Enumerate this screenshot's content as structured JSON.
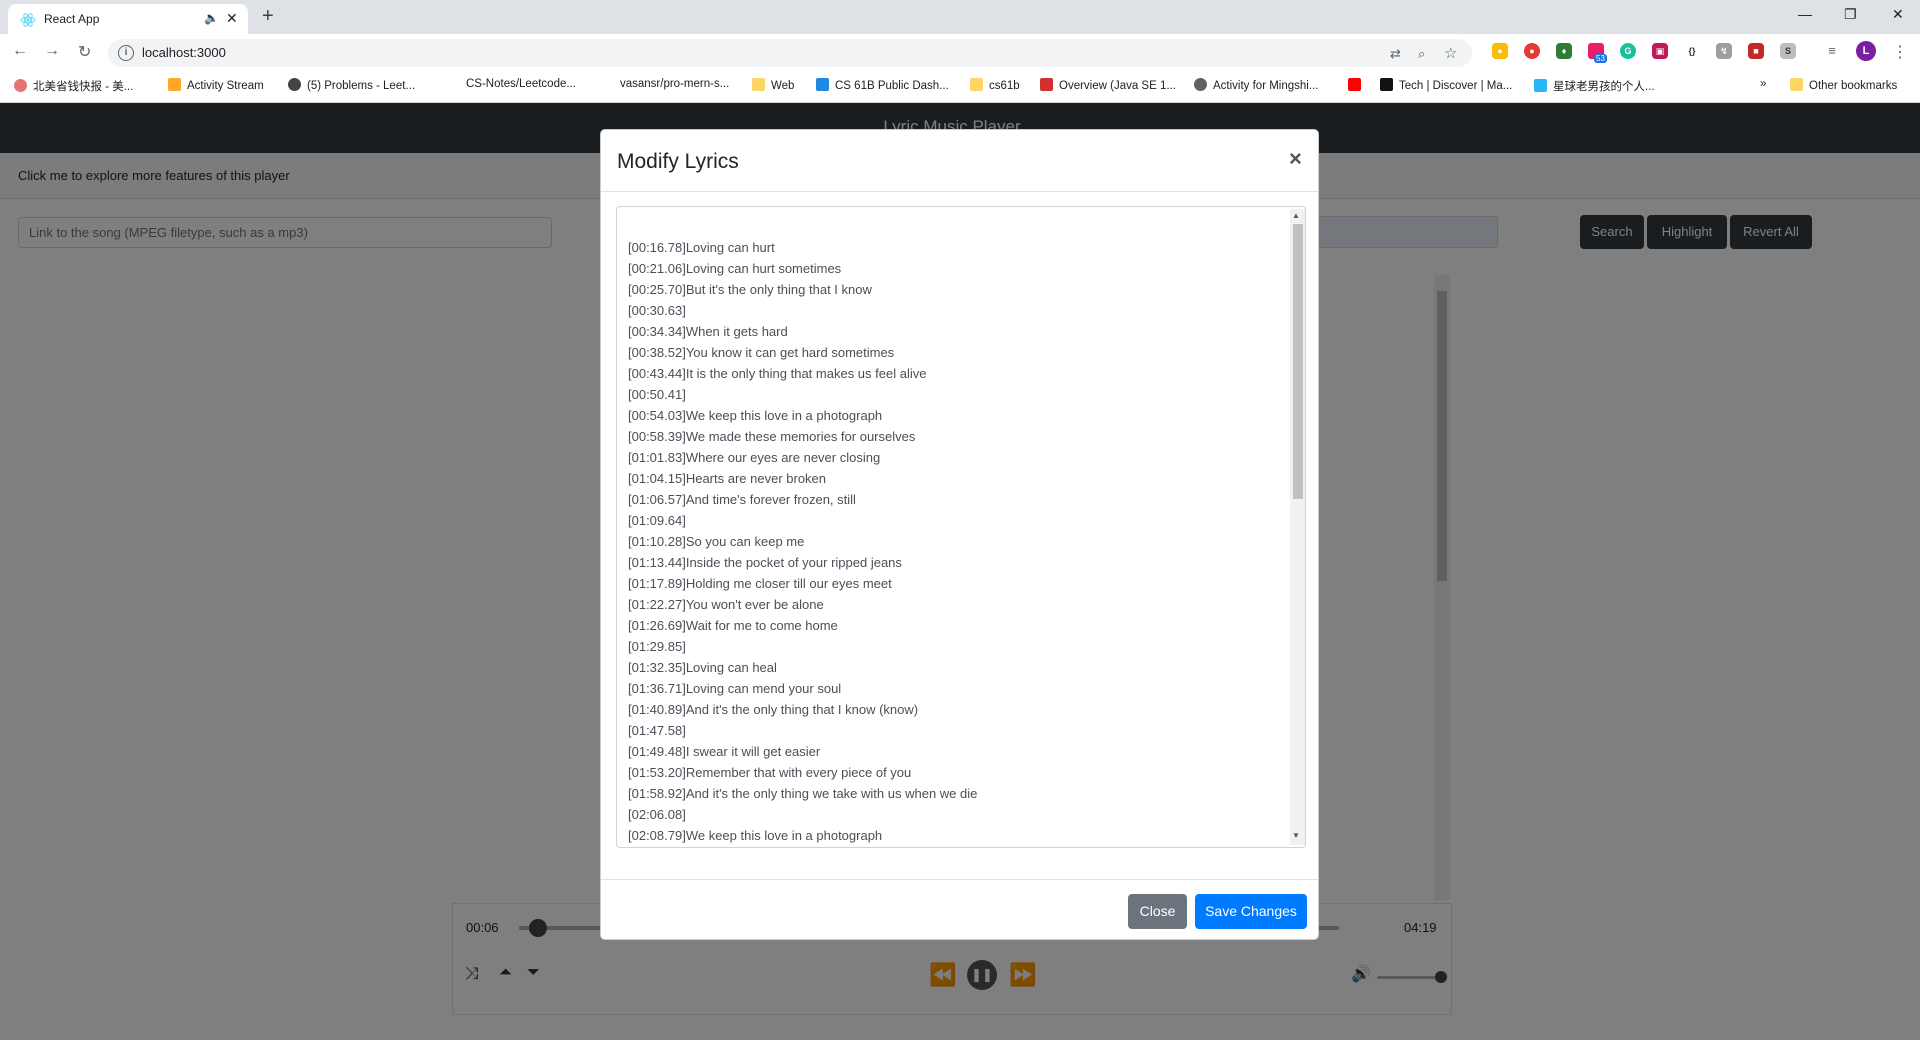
{
  "browser": {
    "tab_title": "React App",
    "url": "localhost:3000",
    "bookmarks": [
      "北美省钱快报 - 美...",
      "Activity Stream",
      "(5) Problems - Leet...",
      "CS-Notes/Leetcode...",
      "vasansr/pro-mern-s...",
      "Web",
      "CS 61B Public Dash...",
      "cs61b",
      "Overview (Java SE 1...",
      "Activity for Mingshi...",
      "Tech | Discover | Ma...",
      "星球老男孩的个人...",
      "»",
      "Other bookmarks"
    ],
    "extension_badge": "53",
    "profile_initial": "L"
  },
  "app": {
    "title": "Lyric Music Player",
    "features_toggle": "Click me to explore more features of this player",
    "song_input_placeholder": "Link to the song (MPEG filetype, such as a mp3)",
    "buttons": {
      "search": "Search",
      "highlight": "Highlight",
      "revert": "Revert All"
    },
    "player": {
      "elapsed": "00:06",
      "duration": "04:19",
      "progress": 0.023,
      "volume": 1.0
    }
  },
  "modal": {
    "title": "Modify Lyrics",
    "close_symbol": "×",
    "lyrics": [
      "[00:16.78]Loving can hurt",
      "[00:21.06]Loving can hurt sometimes",
      "[00:25.70]But it's the only thing that I know",
      "[00:30.63]",
      "[00:34.34]When it gets hard",
      "[00:38.52]You know it can get hard sometimes",
      "[00:43.44]It is the only thing that makes us feel alive",
      "[00:50.41]",
      "[00:54.03]We keep this love in a photograph",
      "[00:58.39]We made these memories for ourselves",
      "[01:01.83]Where our eyes are never closing",
      "[01:04.15]Hearts are never broken",
      "[01:06.57]And time's forever frozen, still",
      "[01:09.64]",
      "[01:10.28]So you can keep me",
      "[01:13.44]Inside the pocket of your ripped jeans",
      "[01:17.89]Holding me closer till our eyes meet",
      "[01:22.27]You won't ever be alone",
      "[01:26.69]Wait for me to come home",
      "[01:29.85]",
      "[01:32.35]Loving can heal",
      "[01:36.71]Loving can mend your soul",
      "[01:40.89]And it's the only thing that I know (know)",
      "[01:47.58]",
      "[01:49.48]I swear it will get easier",
      "[01:53.20]Remember that with every piece of you",
      "[01:58.92]And it's the only thing we take with us when we die",
      "[02:06.08]",
      "[02:08.79]We keep this love in a photograph"
    ],
    "close_button": "Close",
    "save_button": "Save Changes"
  },
  "icons": {
    "back": "arrow-left-icon",
    "forward": "arrow-right-icon",
    "reload": "reload-icon",
    "shuffle": "shuffle-icon",
    "prev": "rewind-icon",
    "play_pause": "pause-icon",
    "next": "fast-forward-icon",
    "volume": "volume-icon"
  },
  "colors": {
    "primary": "#007bff",
    "secondary": "#6c757d",
    "dark": "#343a40"
  }
}
